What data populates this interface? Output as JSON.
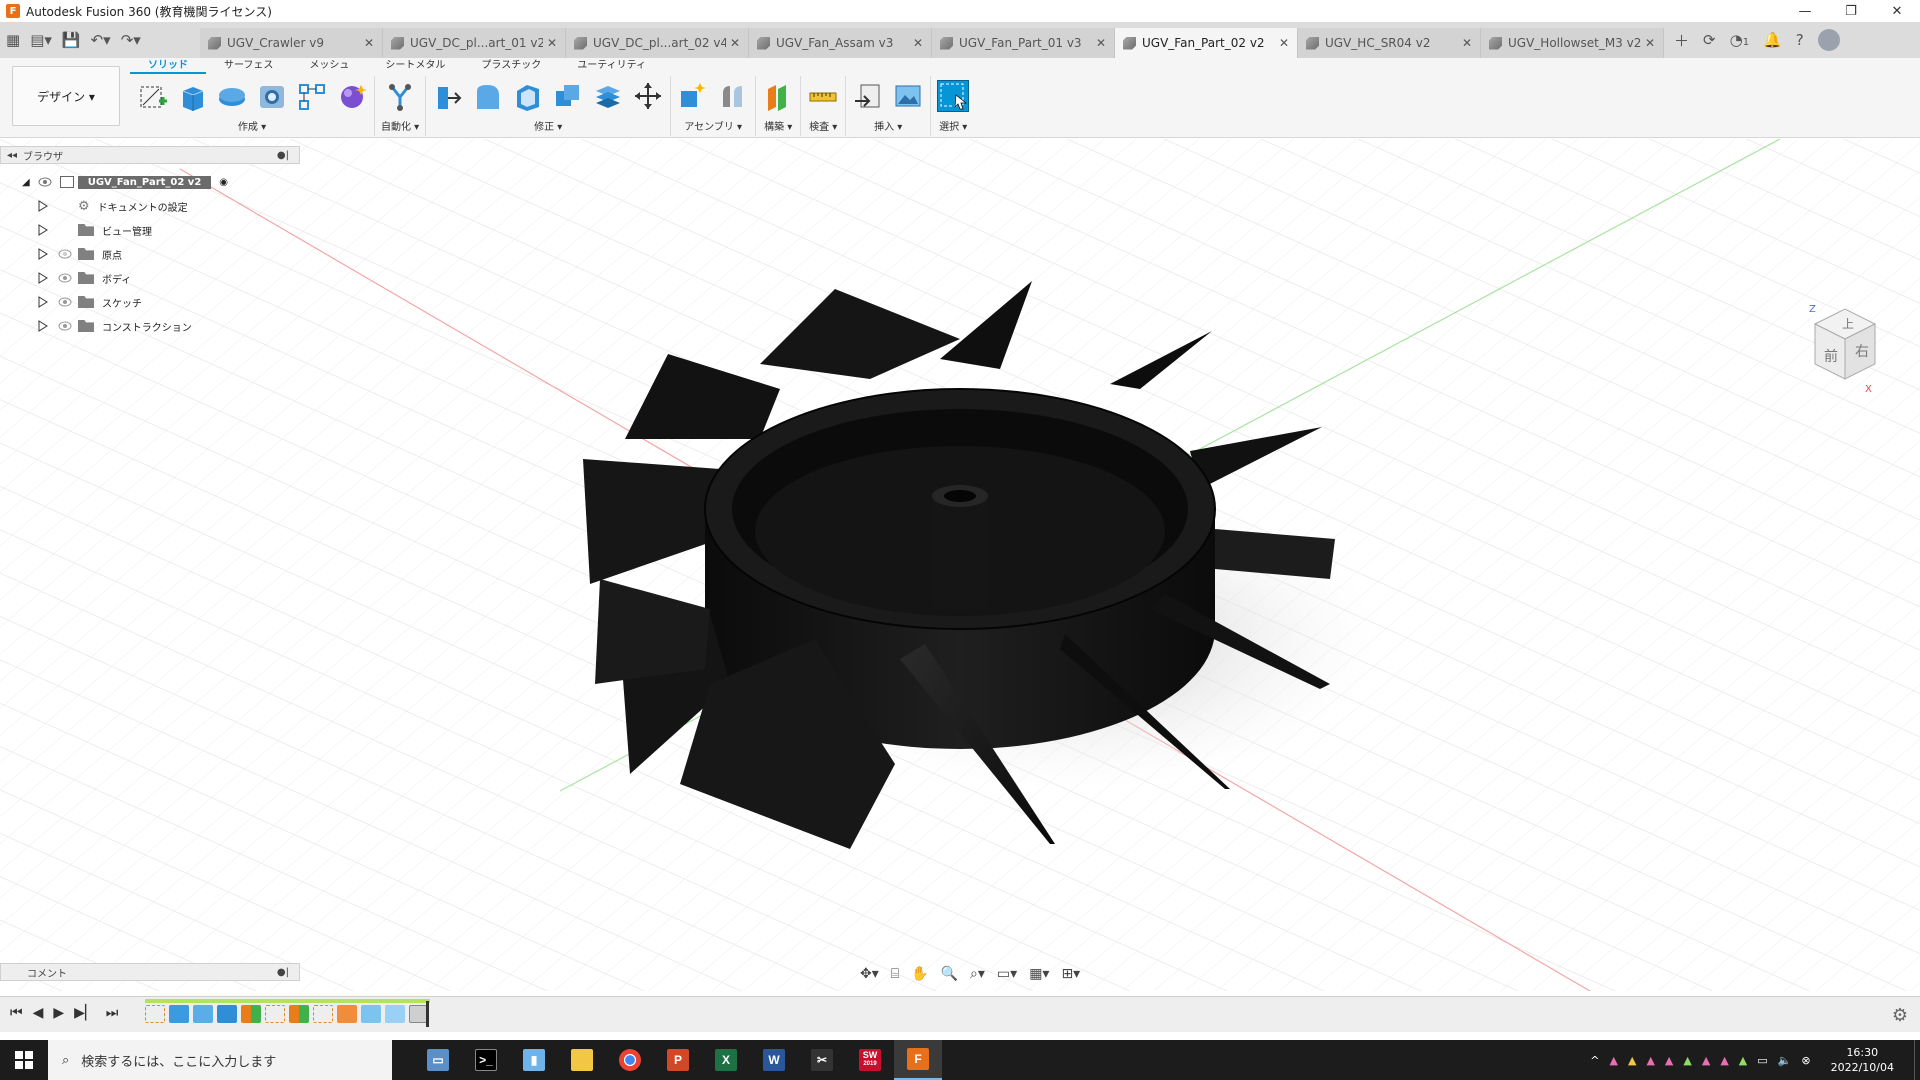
{
  "window": {
    "title": "Autodesk Fusion 360 (教育機関ライセンス)",
    "logo_letter": "F"
  },
  "tabs": [
    {
      "label": "UGV_Crawler v9"
    },
    {
      "label": "UGV_DC_pl...art_01 v2"
    },
    {
      "label": "UGV_DC_pl...art_02 v4"
    },
    {
      "label": "UGV_Fan_Assam v3"
    },
    {
      "label": "UGV_Fan_Part_01 v3"
    },
    {
      "label": "UGV_Fan_Part_02 v2"
    },
    {
      "label": "UGV_HC_SR04 v2"
    },
    {
      "label": "UGV_Hollowset_M3 v2"
    }
  ],
  "active_tab_index": 5,
  "jobs_count": "1",
  "ribbon": {
    "workspace": "デザイン ▾",
    "tabs": [
      "ソリッド",
      "サーフェス",
      "メッシュ",
      "シートメタル",
      "プラスチック",
      "ユーティリティ"
    ],
    "active_tab": "ソリッド",
    "groups": {
      "create": "作成 ▾",
      "automate": "自動化 ▾",
      "modify": "修正 ▾",
      "assemble": "アセンブリ ▾",
      "construct": "構築 ▾",
      "inspect": "検査 ▾",
      "insert": "挿入 ▾",
      "select": "選択 ▾"
    }
  },
  "browser": {
    "title": "ブラウザ",
    "root": "UGV_Fan_Part_02 v2",
    "items": [
      {
        "label": "ドキュメントの設定"
      },
      {
        "label": "ビュー管理"
      },
      {
        "label": "原点"
      },
      {
        "label": "ボディ"
      },
      {
        "label": "スケッチ"
      },
      {
        "label": "コンストラクション"
      }
    ]
  },
  "viewcube": {
    "top": "上",
    "front": "前",
    "right": "右",
    "axis_z": "Z",
    "axis_x": "X"
  },
  "comments": {
    "title": "コメント"
  },
  "taskbar": {
    "search_placeholder": "検索するには、ここに入力します",
    "time": "16:30",
    "date": "2022/10/04",
    "solidworks_label": "SW",
    "solidworks_year": "2019"
  },
  "colors": {
    "accent": "#0696d7",
    "fusion_orange": "#e8701a",
    "timeline_green": "#b5e25c",
    "model_black": "#141414"
  }
}
